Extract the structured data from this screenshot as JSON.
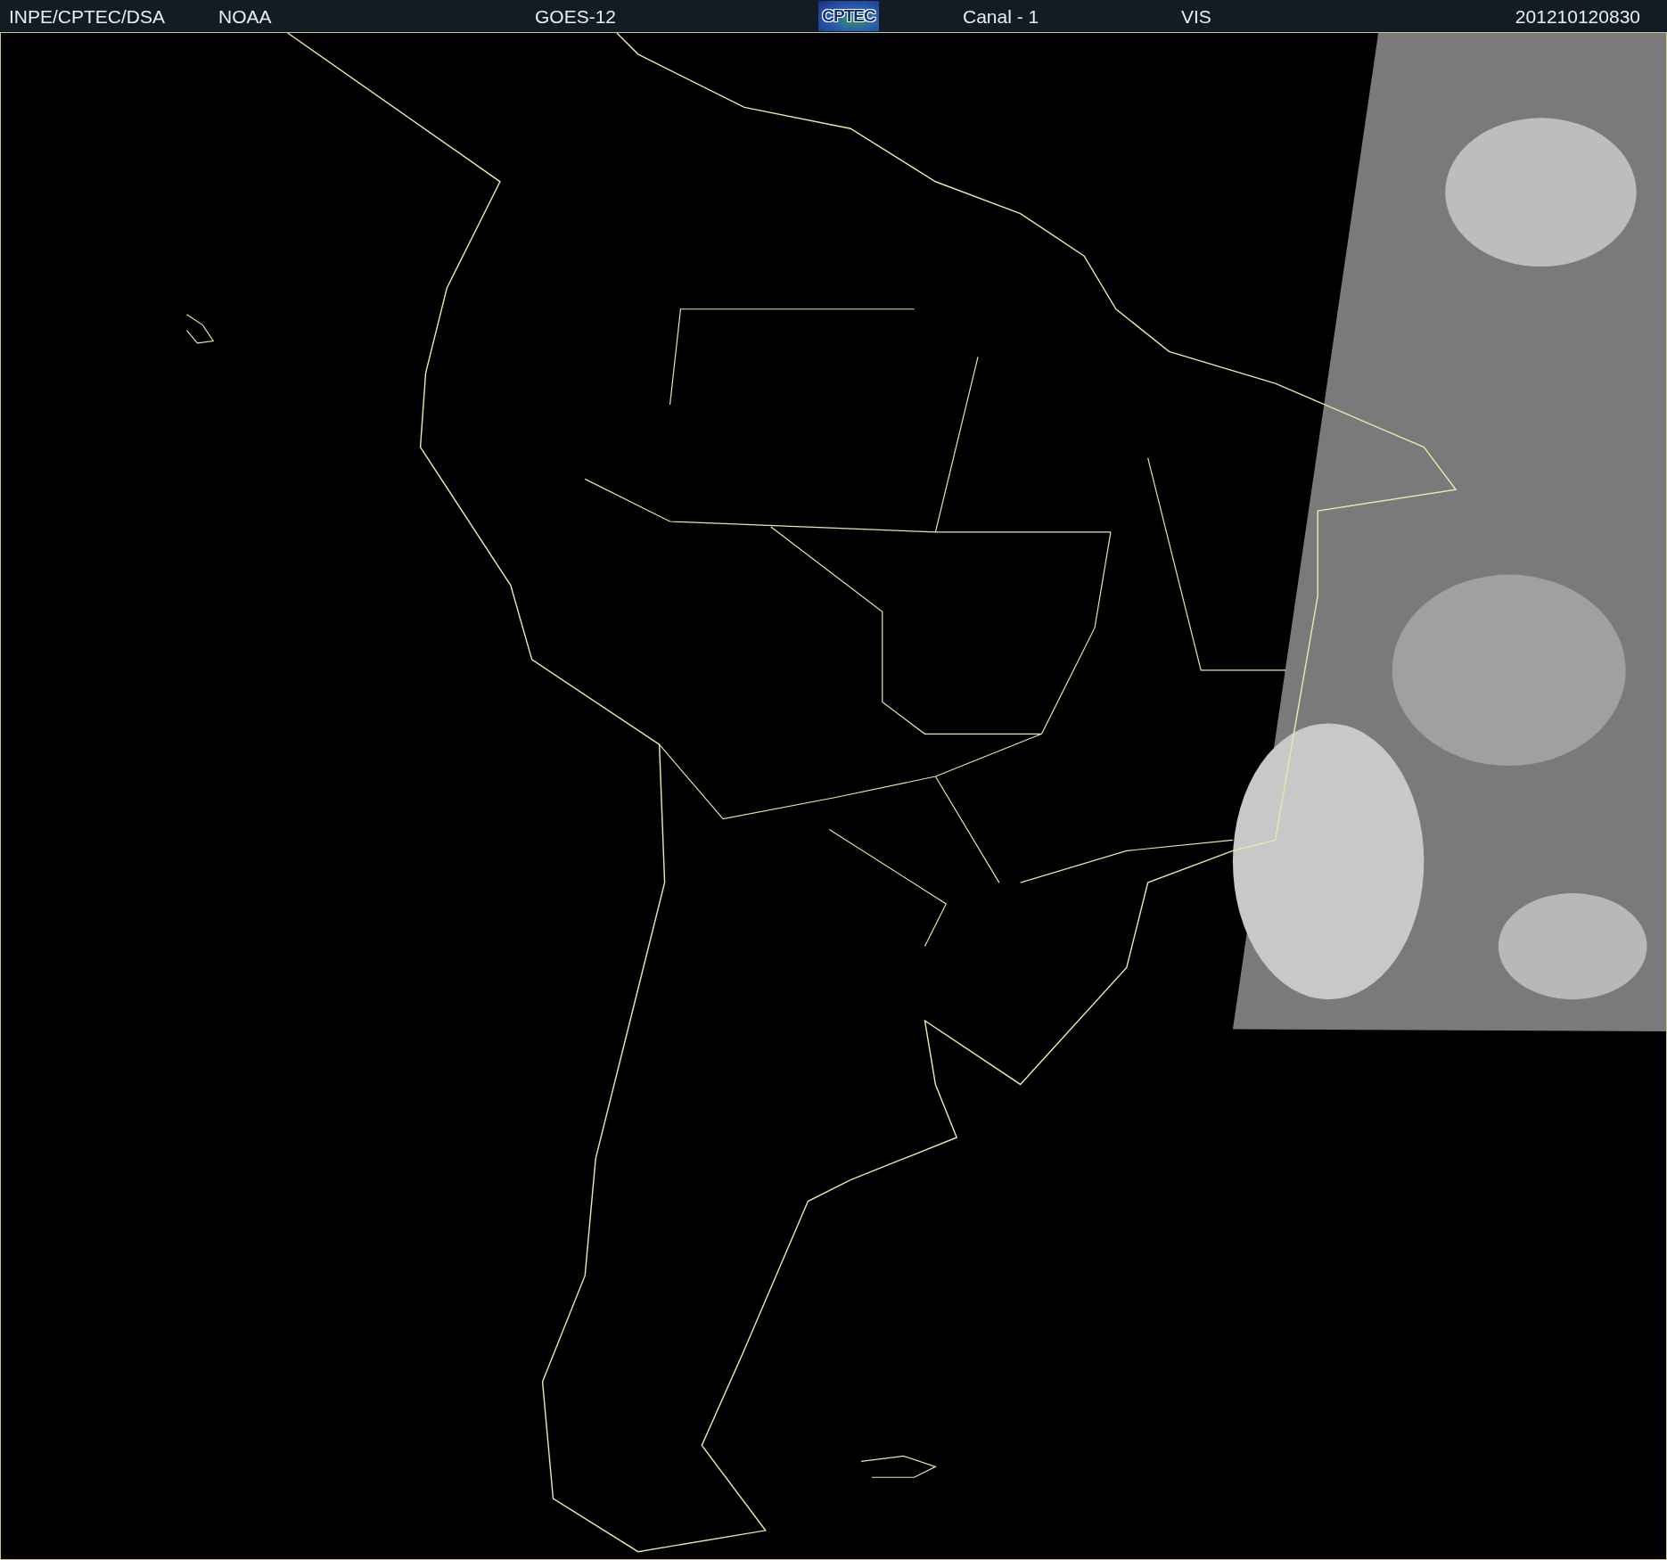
{
  "header": {
    "items": [
      {
        "kind": "text",
        "text": "INPE/CPTEC/DSA"
      },
      {
        "kind": "text",
        "text": "NOAA"
      },
      {
        "kind": "text",
        "text": "GOES-12"
      },
      {
        "kind": "logo",
        "text": "CPTEC"
      },
      {
        "kind": "text",
        "text": "Canal - 1"
      },
      {
        "kind": "text",
        "text": "VIS"
      },
      {
        "kind": "text",
        "text": "201210120830"
      }
    ]
  }
}
